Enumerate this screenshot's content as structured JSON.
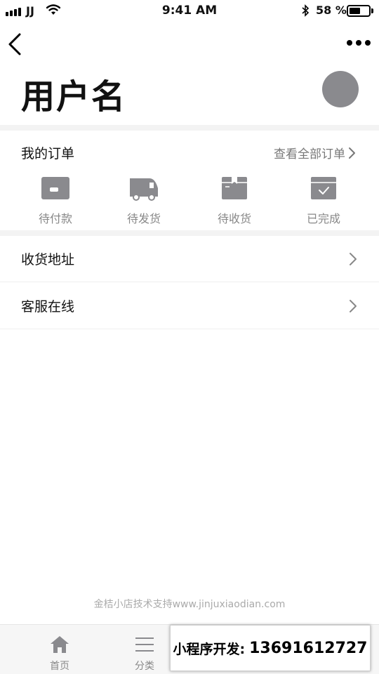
{
  "status_bar": {
    "carrier": "JJ",
    "time": "9:41 AM",
    "battery": "58 %",
    "battery_level": 0.58
  },
  "header": {
    "username": "用户名"
  },
  "orders": {
    "title": "我的订单",
    "view_all": "查看全部订单",
    "items": [
      {
        "label": "待付款",
        "icon": "wallet-icon"
      },
      {
        "label": "待发货",
        "icon": "truck-icon"
      },
      {
        "label": "待收货",
        "icon": "box-icon"
      },
      {
        "label": "已完成",
        "icon": "check-box-icon"
      }
    ]
  },
  "menu": [
    {
      "label": "收货地址"
    },
    {
      "label": "客服在线"
    }
  ],
  "footer": {
    "support_text": "金桔小店技术支持www.jinjuxiaodian.com"
  },
  "tabbar": {
    "tabs": [
      {
        "label": "首页",
        "icon": "home-icon"
      },
      {
        "label": "分类",
        "icon": "list-icon"
      }
    ]
  },
  "promo": {
    "label": "小程序开发:",
    "phone": "13691612727"
  },
  "colors": {
    "icon_gray": "#8a8a8e",
    "text_muted": "#888888",
    "band": "#f3f3f3"
  }
}
